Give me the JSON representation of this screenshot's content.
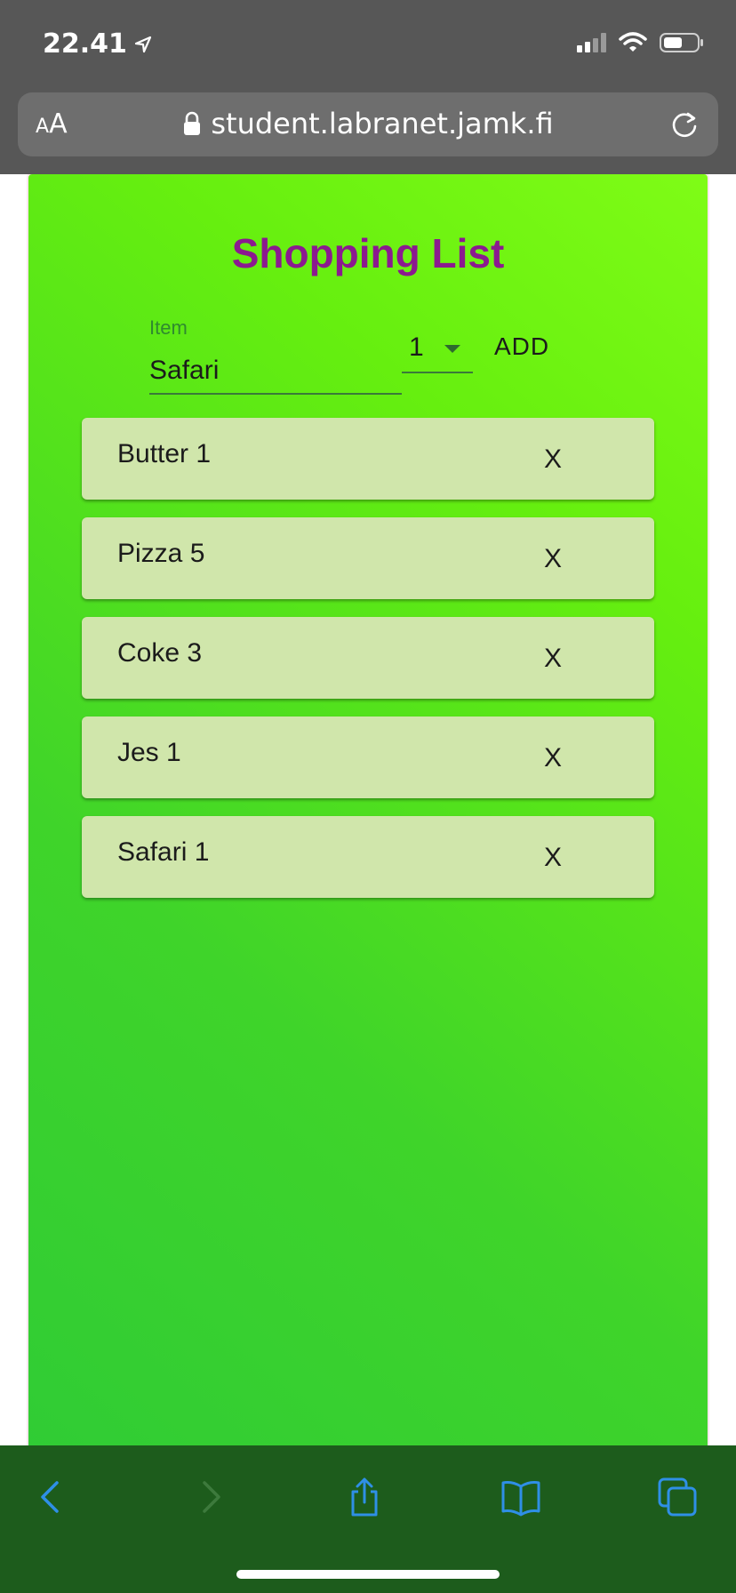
{
  "status_bar": {
    "time": "22.41"
  },
  "address_bar": {
    "aa_small": "A",
    "aa_big": "A",
    "url": "student.labranet.jamk.fi"
  },
  "app": {
    "title": "Shopping List",
    "item_label": "Item",
    "item_value": "Safari",
    "quantity": "1",
    "add_label": "ADD",
    "delete_label": "X",
    "items": [
      {
        "name": "Butter",
        "qty": "1"
      },
      {
        "name": "Pizza",
        "qty": "5"
      },
      {
        "name": "Coke",
        "qty": "3"
      },
      {
        "name": "Jes",
        "qty": "1"
      },
      {
        "name": "Safari",
        "qty": "1"
      }
    ]
  },
  "toolbar": {
    "icons": [
      "back-icon",
      "forward-icon",
      "share-icon",
      "bookmarks-icon",
      "tabs-icon"
    ]
  },
  "colors": {
    "title": "#8b1a8f",
    "item_bg": "#d0e6ab",
    "toolbar_icon": "#2f8fe6",
    "toolbar_icon_disabled": "#3d7a3c"
  }
}
